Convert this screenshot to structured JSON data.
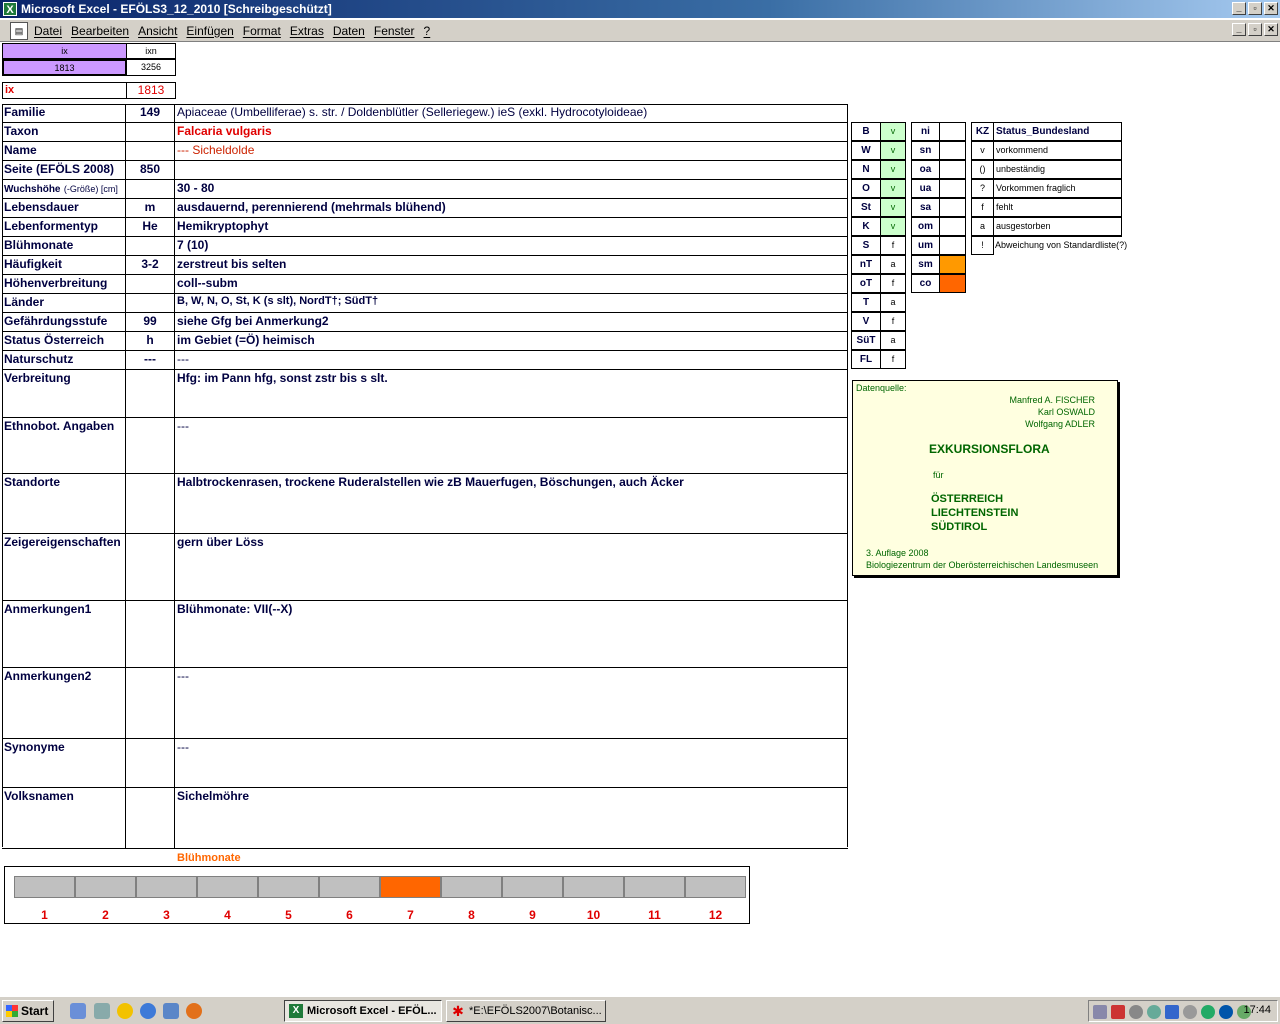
{
  "window": {
    "title": "Microsoft Excel - EFÖLS3_12_2010  [Schreibgeschützt]",
    "app_icon": "excel-icon"
  },
  "menu": [
    "Datei",
    "Bearbeiten",
    "Ansicht",
    "Einfügen",
    "Format",
    "Extras",
    "Daten",
    "Fenster",
    "?"
  ],
  "window_buttons": {
    "min": "_",
    "max": "▫",
    "close": "✕"
  },
  "top": {
    "ix_hdr": "ix",
    "ixn_hdr": "ixn",
    "ix_val": "1813",
    "ixn_val": "3256",
    "ix_lbl": "ix",
    "ix_big": "1813"
  },
  "rows": [
    {
      "label": "Familie",
      "code": "149",
      "text": "Apiaceae (Umbelliferae) s. str.  /  Doldenblütler (Selleriegew.) ieS (exkl. Hydrocotyloideae)"
    },
    {
      "label": "Taxon",
      "code": "",
      "text": "Falcaria vulgaris"
    },
    {
      "label": "Name",
      "code": "",
      "text": " --- Sicheldolde"
    },
    {
      "label": "Seite (EFÖLS 2008)",
      "code": "850",
      "text": ""
    },
    {
      "label": "Wuchshöhe",
      "label_suffix": "(-Größe) [cm]",
      "code": "",
      "text": " 30 - 80"
    },
    {
      "label": "Lebensdauer",
      "code": "m",
      "text": "ausdauernd, perennierend (mehrmals blühend)"
    },
    {
      "label": "Lebenformentyp",
      "code": "He",
      "text": "Hemikryptophyt"
    },
    {
      "label": "Blühmonate",
      "code": "",
      "text": " 7 (10)"
    },
    {
      "label": "Häufigkeit",
      "code": "3-2",
      "text": "zerstreut bis selten"
    },
    {
      "label": "Höhenverbreitung",
      "code": "",
      "text": "coll--subm"
    },
    {
      "label": "Länder",
      "code": "",
      "text": "B, W, N, O, St, K (s slt), NordT†; SüdT†"
    },
    {
      "label": "Gefährdungsstufe",
      "code": "99",
      "text": "siehe Gfg bei Anmerkung2"
    },
    {
      "label": "Status Österreich",
      "code": "h",
      "text": "im Gebiet (=Ö) heimisch"
    },
    {
      "label": "Naturschutz",
      "code": "---",
      "text": " ---"
    },
    {
      "label": "Verbreitung",
      "code": "",
      "text": "Hfg: im Pann hfg, sonst zstr bis s slt."
    },
    {
      "label": "Ethnobot. Angaben",
      "code": "",
      "text": "---"
    },
    {
      "label": "Standorte",
      "code": "",
      "text": "Halbtrockenrasen, trockene Ruderalstellen wie zB Mauerfugen, Böschungen, auch Äcker"
    },
    {
      "label": "Zeigereigenschaften",
      "code": "",
      "text": "gern über Löss"
    },
    {
      "label": "Anmerkungen1",
      "code": "",
      "text": "Blühmonate: VII(--X)"
    },
    {
      "label": "Anmerkungen2",
      "code": "",
      "text": "---"
    },
    {
      "label": "Synonyme",
      "code": "",
      "text": "---"
    },
    {
      "label": "Volksnamen",
      "code": "",
      "text": "Sichelmöhre"
    }
  ],
  "states": [
    {
      "k": "B",
      "v": "v"
    },
    {
      "k": "W",
      "v": "v"
    },
    {
      "k": "N",
      "v": "v"
    },
    {
      "k": "O",
      "v": "v"
    },
    {
      "k": "St",
      "v": "v"
    },
    {
      "k": "K",
      "v": "v"
    },
    {
      "k": "S",
      "v": "f"
    },
    {
      "k": "nT",
      "v": "a"
    },
    {
      "k": "oT",
      "v": "f"
    },
    {
      "k": "T",
      "v": "a"
    },
    {
      "k": "V",
      "v": "f"
    },
    {
      "k": "SüT",
      "v": "a"
    },
    {
      "k": "FL",
      "v": "f"
    }
  ],
  "heights": [
    {
      "k": "ni",
      "v": ""
    },
    {
      "k": "sn",
      "v": ""
    },
    {
      "k": "oa",
      "v": ""
    },
    {
      "k": "ua",
      "v": ""
    },
    {
      "k": "sa",
      "v": ""
    },
    {
      "k": "om",
      "v": ""
    },
    {
      "k": "um",
      "v": ""
    },
    {
      "k": "sm",
      "v": "",
      "color": "#ff9900"
    },
    {
      "k": "co",
      "v": "",
      "color": "#ff6600"
    }
  ],
  "legend": {
    "header_kz": "KZ",
    "header_status": "Status_Bundesland",
    "items": [
      {
        "kz": "v",
        "text": "vorkommend"
      },
      {
        "kz": "()",
        "text": "unbeständig"
      },
      {
        "kz": "?",
        "text": "Vorkommen fraglich"
      },
      {
        "kz": "f",
        "text": "fehlt"
      },
      {
        "kz": "a",
        "text": "ausgestorben"
      },
      {
        "kz": "!",
        "text": "Abweichung von Standardliste(?)"
      }
    ]
  },
  "infobox": {
    "source": "Datenquelle:",
    "authors": [
      "Manfred A. FISCHER",
      "Karl OSWALD",
      "Wolfgang ADLER"
    ],
    "book": "EXKURSIONSFLORA",
    "fuer": "für",
    "regions": [
      "ÖSTERREICH",
      "LIECHTENSTEIN",
      "SÜDTIROL"
    ],
    "edition": "3. Auflage 2008",
    "publisher": "Biologiezentrum der Oberösterreichischen Landesmuseen"
  },
  "bloom": {
    "title": "Blühmonate",
    "months": [
      "1",
      "2",
      "3",
      "4",
      "5",
      "6",
      "7",
      "8",
      "9",
      "10",
      "11",
      "12"
    ],
    "active": [
      7
    ],
    "active_color": "#ff6600"
  },
  "taskbar": {
    "start": "Start",
    "tasks": [
      "Microsoft Excel - EFÖL...",
      "*E:\\EFÖLS2007\\Botanisc..."
    ],
    "clock": "17:44"
  }
}
